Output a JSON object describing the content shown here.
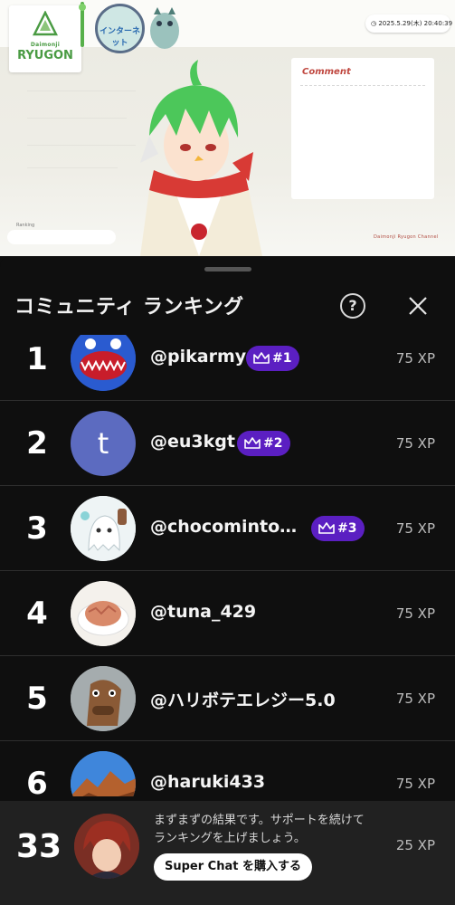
{
  "stream": {
    "logo_small": "Daimonji",
    "logo_big": "RYUGON",
    "badge_text": "インターネット",
    "datetime": "2025.5.29(木) 20:40:39",
    "comment_label": "Comment",
    "ranking_label": "Ranking",
    "channel_label": "Daimonji Ryugon Channel"
  },
  "sheet": {
    "title": "コミュニティ ランキング",
    "help_label": "?"
  },
  "ranking": [
    {
      "rank": "1",
      "handle": "@pikarmy",
      "badge": "#1",
      "xp": "75 XP",
      "avatar": "monster-avatar"
    },
    {
      "rank": "2",
      "handle": "@eu3kgt",
      "badge": "#2",
      "xp": "75 XP",
      "avatar": "letter-avatar",
      "avatar_letter": "t"
    },
    {
      "rank": "3",
      "handle": "@chocomintos...",
      "badge": "#3",
      "xp": "75 XP",
      "avatar": "ghost-avatar"
    },
    {
      "rank": "4",
      "handle": "@tuna_429",
      "badge": "",
      "xp": "75 XP",
      "avatar": "food-avatar"
    },
    {
      "rank": "5",
      "handle": "@ハリボテエレジー5.0",
      "badge": "",
      "xp": "75 XP",
      "avatar": "horse-avatar"
    },
    {
      "rank": "6",
      "handle": "@haruki433",
      "badge": "",
      "xp": "75 XP",
      "avatar": "mountain-avatar"
    }
  ],
  "footer": {
    "rank": "33",
    "message": "まずまずの結果です。サポートを続けてランキングを上げましょう。",
    "button_label": "Super Chat を購入する",
    "xp": "25 XP"
  },
  "colors": {
    "background": "#0f0f0f",
    "badge_purple": "#5b1fc2",
    "letter_avatar": "#5c6bc0",
    "footer_bg": "#212121"
  }
}
